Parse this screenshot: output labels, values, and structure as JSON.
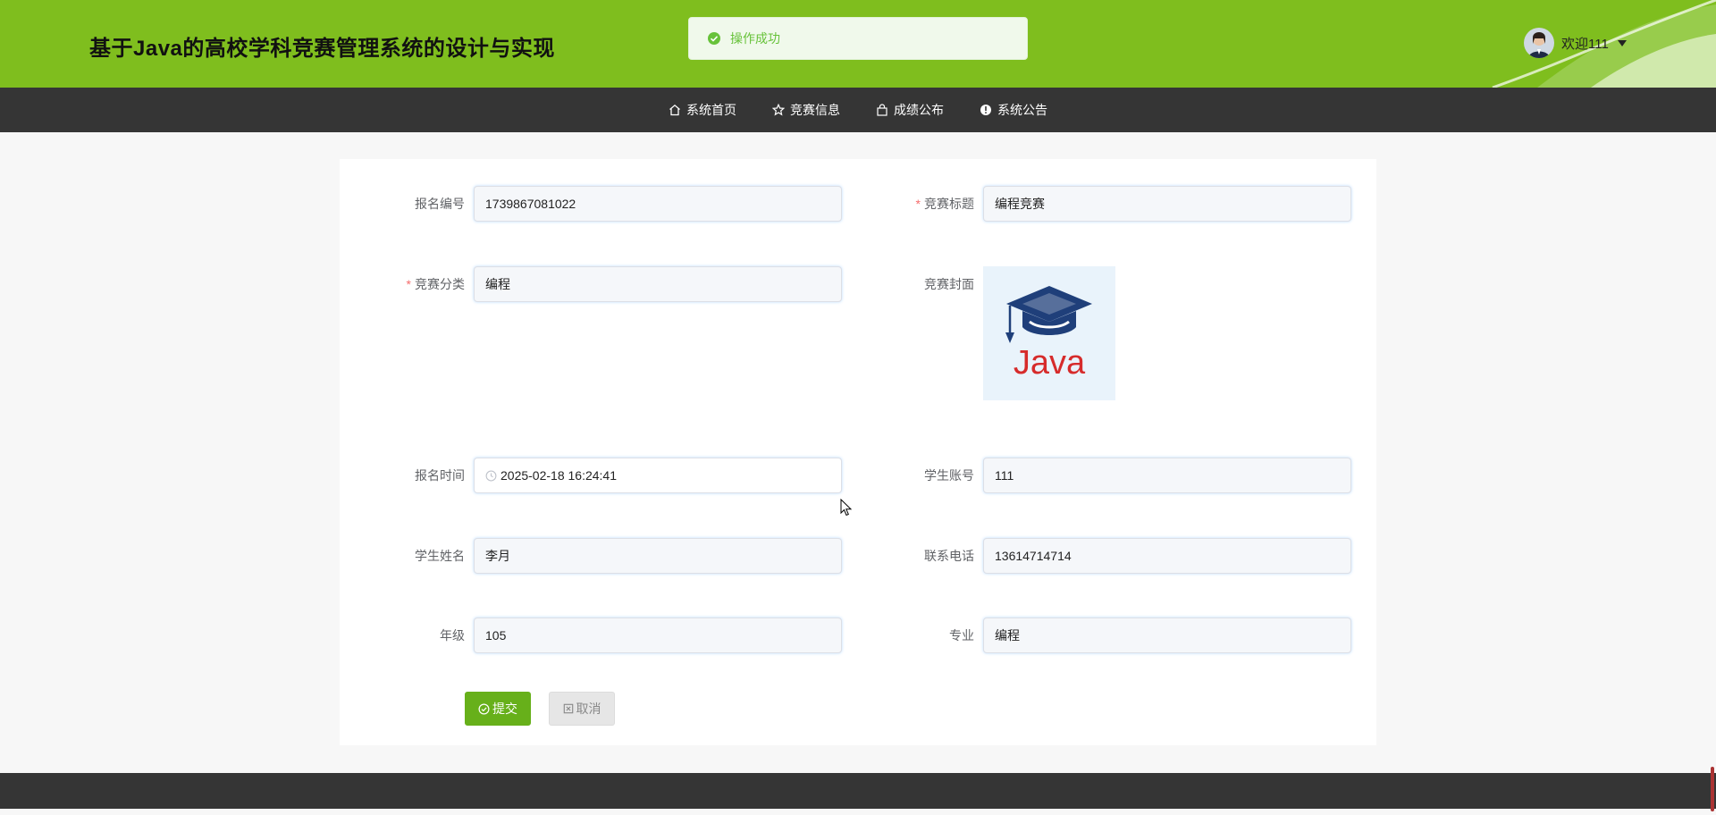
{
  "header": {
    "site_title": "基于Java的高校学科竞赛管理系统的设计与实现",
    "welcome": "欢迎111",
    "accent_color": "#7fbe1e"
  },
  "toast": {
    "message": "操作成功",
    "icon": "check-circle-icon"
  },
  "nav": {
    "items": [
      {
        "label": "系统首页",
        "icon": "home-icon"
      },
      {
        "label": "竞赛信息",
        "icon": "star-icon"
      },
      {
        "label": "成绩公布",
        "icon": "bag-icon"
      },
      {
        "label": "系统公告",
        "icon": "info-icon"
      }
    ]
  },
  "form": {
    "fields": {
      "reg_no": {
        "label": "报名编号",
        "value": "1739867081022",
        "required": false
      },
      "title": {
        "label": "竞赛标题",
        "value": "编程竞赛",
        "required": true
      },
      "category": {
        "label": "竞赛分类",
        "value": "编程",
        "required": true
      },
      "cover": {
        "label": "竞赛封面",
        "image_text": "Java"
      },
      "reg_time": {
        "label": "报名时间",
        "value": "2025-02-18 16:24:41"
      },
      "account": {
        "label": "学生账号",
        "value": "111"
      },
      "name": {
        "label": "学生姓名",
        "value": "李月"
      },
      "phone": {
        "label": "联系电话",
        "value": "13614714714"
      },
      "grade": {
        "label": "年级",
        "value": "105"
      },
      "major": {
        "label": "专业",
        "value": "编程"
      }
    },
    "submit_label": "提交",
    "cancel_label": "取消"
  }
}
